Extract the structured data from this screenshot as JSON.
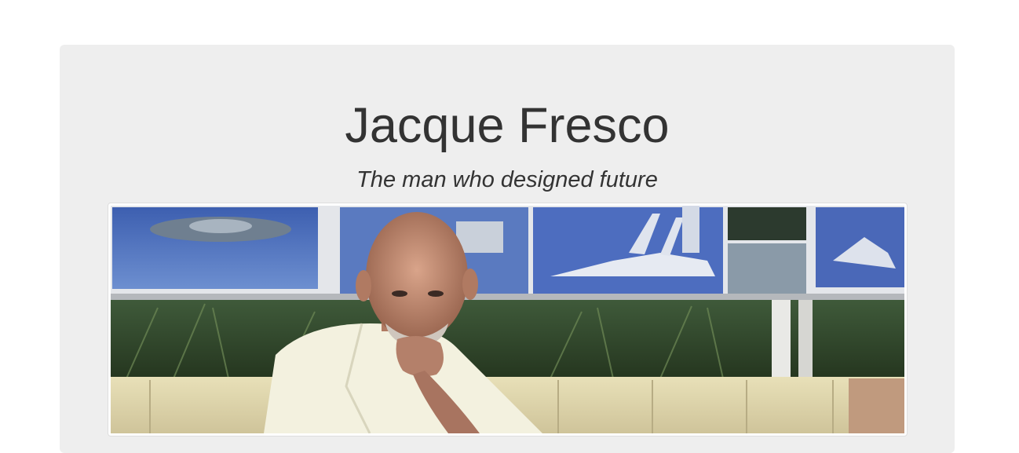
{
  "header": {
    "title": "Jacque Fresco",
    "subtitle": "The man who designed future"
  },
  "photo": {
    "alt": "Jacque Fresco photo",
    "description_icon": "portrait-photo"
  },
  "colors": {
    "page_background": "#ffffff",
    "jumbotron_background": "#eeeeee",
    "text": "#333333"
  }
}
